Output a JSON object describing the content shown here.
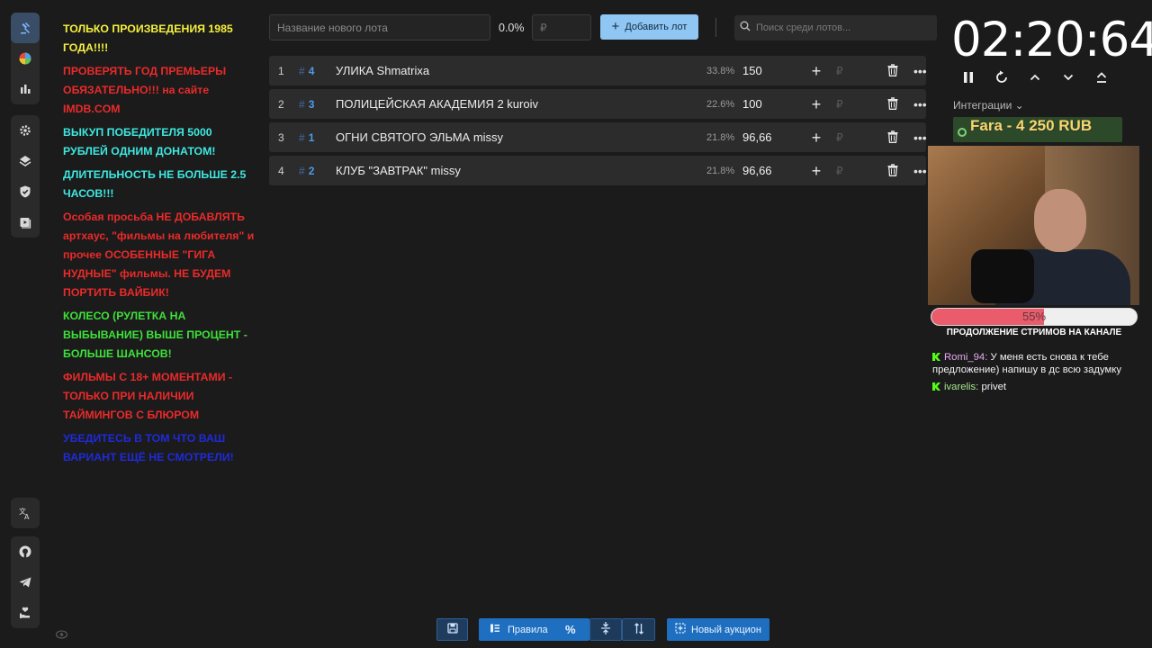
{
  "rules": [
    {
      "text": "ТОЛЬКО ПРОИЗВЕДЕНИЯ 1985 ГОДА!!!!",
      "color": "#f5f03c"
    },
    {
      "text": "ПРОВЕРЯТЬ ГОД ПРЕМЬЕРЫ ОБЯЗАТЕЛЬНО!!! на сайте IMDB.COM",
      "color": "#ea2a2a"
    },
    {
      "text": "ВЫКУП ПОБЕДИТЕЛЯ 5000 РУБЛЕЙ ОДНИМ ДОНАТОМ!",
      "color": "#3de8e0"
    },
    {
      "text": "ДЛИТЕЛЬНОСТЬ НЕ БОЛЬШЕ 2.5 ЧАСОВ!!!",
      "color": "#3de8e0"
    },
    {
      "text": "Особая просьба НЕ ДОБАВЛЯТЬ артхаус, \"фильмы на любителя\" и прочее ОСОБЕННЫЕ \"ГИГА НУДНЫЕ\" фильмы. НЕ БУДЕМ ПОРТИТЬ ВАЙБИК!",
      "color": "#ea2a2a"
    },
    {
      "text": "КОЛЕСО (РУЛЕТКА НА ВЫБЫВАНИЕ) ВЫШЕ ПРОЦЕНТ - БОЛЬШЕ ШАНСОВ!",
      "color": "#3ee03a"
    },
    {
      "text": "ФИЛЬМЫ С 18+ МОМЕНТАМИ - ТОЛЬКО ПРИ НАЛИЧИИ ТАЙМИНГОВ С БЛЮРОМ",
      "color": "#ea2a2a"
    },
    {
      "text": "УБЕДИТЕСЬ В ТОМ ЧТО ВАШ ВАРИАНТ ЕЩЁ НЕ СМОТРЕЛИ!",
      "color": "#1f2ad8"
    }
  ],
  "toolbar": {
    "lot_placeholder": "Название нового лота",
    "percent": "0.0%",
    "amount_placeholder": "₽",
    "add_label": "Добавить лот",
    "search_placeholder": "Поиск среди лотов..."
  },
  "lots": [
    {
      "num": "1",
      "id": "4",
      "name": "УЛИКА Shmatrixa",
      "pct": "33.8%",
      "amount": "150",
      "rub": "₽"
    },
    {
      "num": "2",
      "id": "3",
      "name": "ПОЛИЦЕЙСКАЯ АКАДЕМИЯ 2 kuroiv",
      "pct": "22.6%",
      "amount": "100",
      "rub": "₽"
    },
    {
      "num": "3",
      "id": "1",
      "name": "ОГНИ СВЯТОГО ЭЛЬМА missy",
      "pct": "21.8%",
      "amount": "96,66",
      "rub": "₽"
    },
    {
      "num": "4",
      "id": "2",
      "name": "КЛУБ \"ЗАВТРАК\" missy",
      "pct": "21.8%",
      "amount": "96,66",
      "rub": "₽"
    }
  ],
  "timer": {
    "value": "02:20:64"
  },
  "integrations": {
    "label": "Интеграции ⌄"
  },
  "donation": {
    "text": "Fara - 4 250 RUB"
  },
  "progress": {
    "value": 0.55,
    "label": "55%",
    "caption": "ПРОДОЛЖЕНИЕ СТРИМОВ НА КАНАЛЕ"
  },
  "chat": [
    {
      "user": "Romi_94",
      "message": "У меня есть снова к тебе предложение) напишу в дс всю задумку"
    },
    {
      "user": "ivarelis",
      "message": "privet"
    }
  ],
  "bottom": {
    "rules_label": "Правила",
    "new_auction_label": "Новый аукцион"
  },
  "colors": {
    "accent": "#1f6fc1",
    "add_button": "#90c6f4",
    "lot_id": "#4f9ae6"
  }
}
